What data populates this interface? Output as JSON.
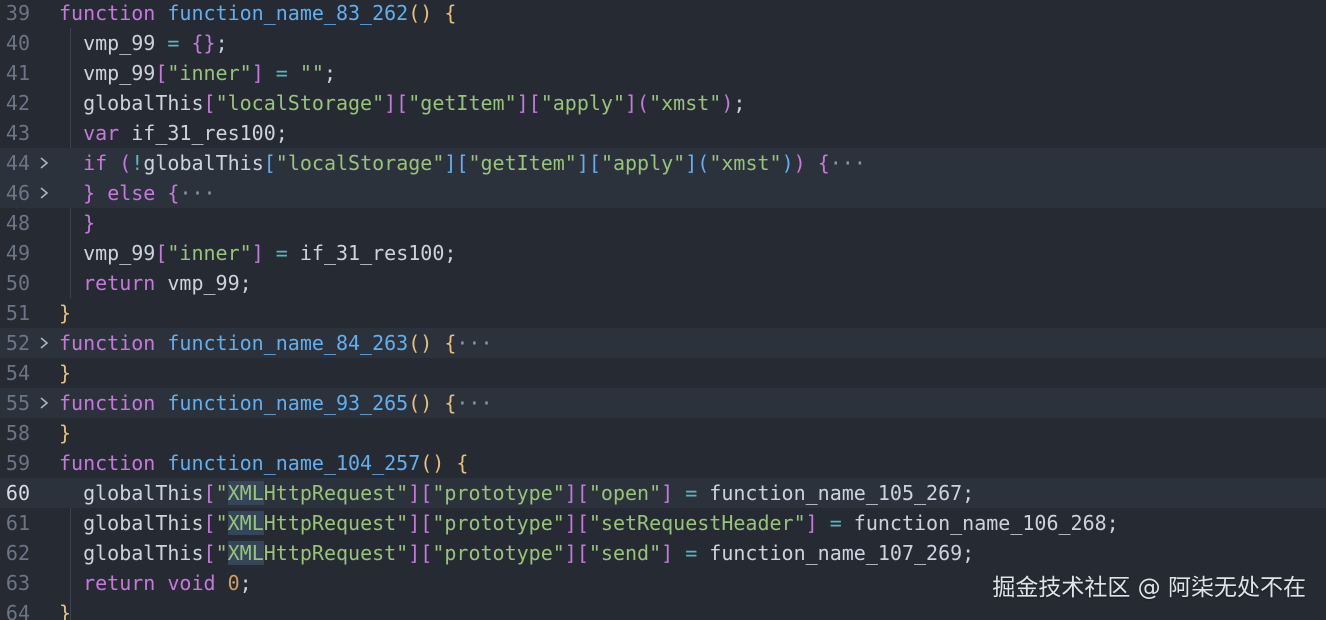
{
  "editor": {
    "theme_colors": {
      "background": "#262b33",
      "keyword": "#c678dd",
      "function": "#61afef",
      "string": "#98c379",
      "number": "#d19a66",
      "operator": "#56b6c2",
      "bracket_level1": "#e5c07b",
      "bracket_level2": "#c678dd",
      "bracket_level3": "#61afef",
      "line_number": "#6b7585"
    },
    "current_line": "60",
    "lines": [
      {
        "num": "39",
        "fold": false,
        "highlight": false,
        "current": false,
        "tokens": [
          {
            "t": "function",
            "c": "kw"
          },
          {
            "t": " ",
            "c": "var"
          },
          {
            "t": "function_name_83_262",
            "c": "fn"
          },
          {
            "t": "()",
            "c": "b1"
          },
          {
            "t": " ",
            "c": "var"
          },
          {
            "t": "{",
            "c": "b1"
          }
        ]
      },
      {
        "num": "40",
        "fold": false,
        "highlight": false,
        "current": false,
        "tokens": [
          {
            "t": "  ",
            "c": "var"
          },
          {
            "t": "vmp_99",
            "c": "var"
          },
          {
            "t": " ",
            "c": "var"
          },
          {
            "t": "=",
            "c": "op"
          },
          {
            "t": " ",
            "c": "var"
          },
          {
            "t": "{}",
            "c": "b2"
          },
          {
            "t": ";",
            "c": "punc"
          }
        ]
      },
      {
        "num": "41",
        "fold": false,
        "highlight": false,
        "current": false,
        "tokens": [
          {
            "t": "  ",
            "c": "var"
          },
          {
            "t": "vmp_99",
            "c": "var"
          },
          {
            "t": "[",
            "c": "b2"
          },
          {
            "t": "\"inner\"",
            "c": "str"
          },
          {
            "t": "]",
            "c": "b2"
          },
          {
            "t": " ",
            "c": "var"
          },
          {
            "t": "=",
            "c": "op"
          },
          {
            "t": " ",
            "c": "var"
          },
          {
            "t": "\"\"",
            "c": "str"
          },
          {
            "t": ";",
            "c": "punc"
          }
        ]
      },
      {
        "num": "42",
        "fold": false,
        "highlight": false,
        "current": false,
        "tokens": [
          {
            "t": "  ",
            "c": "var"
          },
          {
            "t": "globalThis",
            "c": "var"
          },
          {
            "t": "[",
            "c": "b2"
          },
          {
            "t": "\"localStorage\"",
            "c": "str"
          },
          {
            "t": "][",
            "c": "b2"
          },
          {
            "t": "\"getItem\"",
            "c": "str"
          },
          {
            "t": "][",
            "c": "b2"
          },
          {
            "t": "\"apply\"",
            "c": "str"
          },
          {
            "t": "](",
            "c": "b2"
          },
          {
            "t": "\"xmst\"",
            "c": "str"
          },
          {
            "t": ")",
            "c": "b2"
          },
          {
            "t": ";",
            "c": "punc"
          }
        ]
      },
      {
        "num": "43",
        "fold": false,
        "highlight": false,
        "current": false,
        "tokens": [
          {
            "t": "  ",
            "c": "var"
          },
          {
            "t": "var",
            "c": "kw"
          },
          {
            "t": " if_31_res100",
            "c": "var"
          },
          {
            "t": ";",
            "c": "punc"
          }
        ]
      },
      {
        "num": "44",
        "fold": true,
        "highlight": true,
        "current": false,
        "tokens": [
          {
            "t": "  ",
            "c": "var"
          },
          {
            "t": "if",
            "c": "kw"
          },
          {
            "t": " ",
            "c": "var"
          },
          {
            "t": "(",
            "c": "b2"
          },
          {
            "t": "!",
            "c": "op"
          },
          {
            "t": "globalThis",
            "c": "var"
          },
          {
            "t": "[",
            "c": "b3"
          },
          {
            "t": "\"localStorage\"",
            "c": "str"
          },
          {
            "t": "][",
            "c": "b3"
          },
          {
            "t": "\"getItem\"",
            "c": "str"
          },
          {
            "t": "][",
            "c": "b3"
          },
          {
            "t": "\"apply\"",
            "c": "str"
          },
          {
            "t": "](",
            "c": "b3"
          },
          {
            "t": "\"xmst\"",
            "c": "str"
          },
          {
            "t": ")",
            "c": "b3"
          },
          {
            "t": ")",
            "c": "b2"
          },
          {
            "t": " ",
            "c": "var"
          },
          {
            "t": "{",
            "c": "b2"
          },
          {
            "t": "···",
            "c": "dim"
          }
        ]
      },
      {
        "num": "46",
        "fold": true,
        "highlight": true,
        "current": false,
        "tokens": [
          {
            "t": "  ",
            "c": "var"
          },
          {
            "t": "}",
            "c": "b2"
          },
          {
            "t": " ",
            "c": "var"
          },
          {
            "t": "else",
            "c": "kw"
          },
          {
            "t": " ",
            "c": "var"
          },
          {
            "t": "{",
            "c": "b2"
          },
          {
            "t": "···",
            "c": "dim"
          }
        ]
      },
      {
        "num": "48",
        "fold": false,
        "highlight": false,
        "current": false,
        "tokens": [
          {
            "t": "  ",
            "c": "var"
          },
          {
            "t": "}",
            "c": "b2"
          }
        ]
      },
      {
        "num": "49",
        "fold": false,
        "highlight": false,
        "current": false,
        "tokens": [
          {
            "t": "  ",
            "c": "var"
          },
          {
            "t": "vmp_99",
            "c": "var"
          },
          {
            "t": "[",
            "c": "b2"
          },
          {
            "t": "\"inner\"",
            "c": "str"
          },
          {
            "t": "]",
            "c": "b2"
          },
          {
            "t": " ",
            "c": "var"
          },
          {
            "t": "=",
            "c": "op"
          },
          {
            "t": " if_31_res100",
            "c": "var"
          },
          {
            "t": ";",
            "c": "punc"
          }
        ]
      },
      {
        "num": "50",
        "fold": false,
        "highlight": false,
        "current": false,
        "tokens": [
          {
            "t": "  ",
            "c": "var"
          },
          {
            "t": "return",
            "c": "kw"
          },
          {
            "t": " vmp_99",
            "c": "var"
          },
          {
            "t": ";",
            "c": "punc"
          }
        ]
      },
      {
        "num": "51",
        "fold": false,
        "highlight": false,
        "current": false,
        "tokens": [
          {
            "t": "}",
            "c": "b1"
          }
        ]
      },
      {
        "num": "52",
        "fold": true,
        "highlight": true,
        "current": false,
        "tokens": [
          {
            "t": "function",
            "c": "kw"
          },
          {
            "t": " ",
            "c": "var"
          },
          {
            "t": "function_name_84_263",
            "c": "fn"
          },
          {
            "t": "()",
            "c": "b1"
          },
          {
            "t": " ",
            "c": "var"
          },
          {
            "t": "{",
            "c": "b1"
          },
          {
            "t": "···",
            "c": "dim"
          }
        ]
      },
      {
        "num": "54",
        "fold": false,
        "highlight": false,
        "current": false,
        "tokens": [
          {
            "t": "}",
            "c": "b1"
          }
        ]
      },
      {
        "num": "55",
        "fold": true,
        "highlight": true,
        "current": false,
        "tokens": [
          {
            "t": "function",
            "c": "kw"
          },
          {
            "t": " ",
            "c": "var"
          },
          {
            "t": "function_name_93_265",
            "c": "fn"
          },
          {
            "t": "()",
            "c": "b1"
          },
          {
            "t": " ",
            "c": "var"
          },
          {
            "t": "{",
            "c": "b1"
          },
          {
            "t": "···",
            "c": "dim"
          }
        ]
      },
      {
        "num": "58",
        "fold": false,
        "highlight": false,
        "current": false,
        "tokens": [
          {
            "t": "}",
            "c": "b1"
          }
        ]
      },
      {
        "num": "59",
        "fold": false,
        "highlight": false,
        "current": false,
        "tokens": [
          {
            "t": "function",
            "c": "kw"
          },
          {
            "t": " ",
            "c": "var"
          },
          {
            "t": "function_name_104_257",
            "c": "fn"
          },
          {
            "t": "()",
            "c": "b1"
          },
          {
            "t": " ",
            "c": "var"
          },
          {
            "t": "{",
            "c": "b1"
          }
        ]
      },
      {
        "num": "60",
        "fold": false,
        "highlight": true,
        "current": true,
        "tokens": [
          {
            "t": "  ",
            "c": "var"
          },
          {
            "t": "globalThis",
            "c": "var"
          },
          {
            "t": "[",
            "c": "b2"
          },
          {
            "t": "\"",
            "c": "str"
          },
          {
            "t": "XML",
            "c": "str",
            "m": true
          },
          {
            "t": "HttpRequest\"",
            "c": "str"
          },
          {
            "t": "][",
            "c": "b2"
          },
          {
            "t": "\"prototype\"",
            "c": "str"
          },
          {
            "t": "][",
            "c": "b2"
          },
          {
            "t": "\"open\"",
            "c": "str"
          },
          {
            "t": "]",
            "c": "b2"
          },
          {
            "t": " ",
            "c": "var"
          },
          {
            "t": "=",
            "c": "op"
          },
          {
            "t": " function_name_105_267",
            "c": "var"
          },
          {
            "t": ";",
            "c": "punc"
          }
        ]
      },
      {
        "num": "61",
        "fold": false,
        "highlight": false,
        "current": false,
        "tokens": [
          {
            "t": "  ",
            "c": "var"
          },
          {
            "t": "globalThis",
            "c": "var"
          },
          {
            "t": "[",
            "c": "b2"
          },
          {
            "t": "\"",
            "c": "str"
          },
          {
            "t": "XML",
            "c": "str",
            "m": true
          },
          {
            "t": "HttpRequest\"",
            "c": "str"
          },
          {
            "t": "][",
            "c": "b2"
          },
          {
            "t": "\"prototype\"",
            "c": "str"
          },
          {
            "t": "][",
            "c": "b2"
          },
          {
            "t": "\"setRequestHeader\"",
            "c": "str"
          },
          {
            "t": "]",
            "c": "b2"
          },
          {
            "t": " ",
            "c": "var"
          },
          {
            "t": "=",
            "c": "op"
          },
          {
            "t": " function_name_106_268",
            "c": "var"
          },
          {
            "t": ";",
            "c": "punc"
          }
        ]
      },
      {
        "num": "62",
        "fold": false,
        "highlight": false,
        "current": false,
        "tokens": [
          {
            "t": "  ",
            "c": "var"
          },
          {
            "t": "globalThis",
            "c": "var"
          },
          {
            "t": "[",
            "c": "b2"
          },
          {
            "t": "\"",
            "c": "str"
          },
          {
            "t": "XML",
            "c": "str",
            "m": true
          },
          {
            "t": "HttpRequest\"",
            "c": "str"
          },
          {
            "t": "][",
            "c": "b2"
          },
          {
            "t": "\"prototype\"",
            "c": "str"
          },
          {
            "t": "][",
            "c": "b2"
          },
          {
            "t": "\"send\"",
            "c": "str"
          },
          {
            "t": "]",
            "c": "b2"
          },
          {
            "t": " ",
            "c": "var"
          },
          {
            "t": "=",
            "c": "op"
          },
          {
            "t": " function_name_107_269",
            "c": "var"
          },
          {
            "t": ";",
            "c": "punc"
          }
        ]
      },
      {
        "num": "63",
        "fold": false,
        "highlight": false,
        "current": false,
        "tokens": [
          {
            "t": "  ",
            "c": "var"
          },
          {
            "t": "return",
            "c": "kw"
          },
          {
            "t": " ",
            "c": "var"
          },
          {
            "t": "void",
            "c": "kw"
          },
          {
            "t": " ",
            "c": "var"
          },
          {
            "t": "0",
            "c": "num"
          },
          {
            "t": ";",
            "c": "punc"
          }
        ]
      },
      {
        "num": "64",
        "fold": false,
        "highlight": false,
        "current": false,
        "tokens": [
          {
            "t": "}",
            "c": "b1"
          }
        ]
      }
    ]
  },
  "watermark": {
    "text": "掘金技术社区 @ 阿柒无处不在"
  }
}
